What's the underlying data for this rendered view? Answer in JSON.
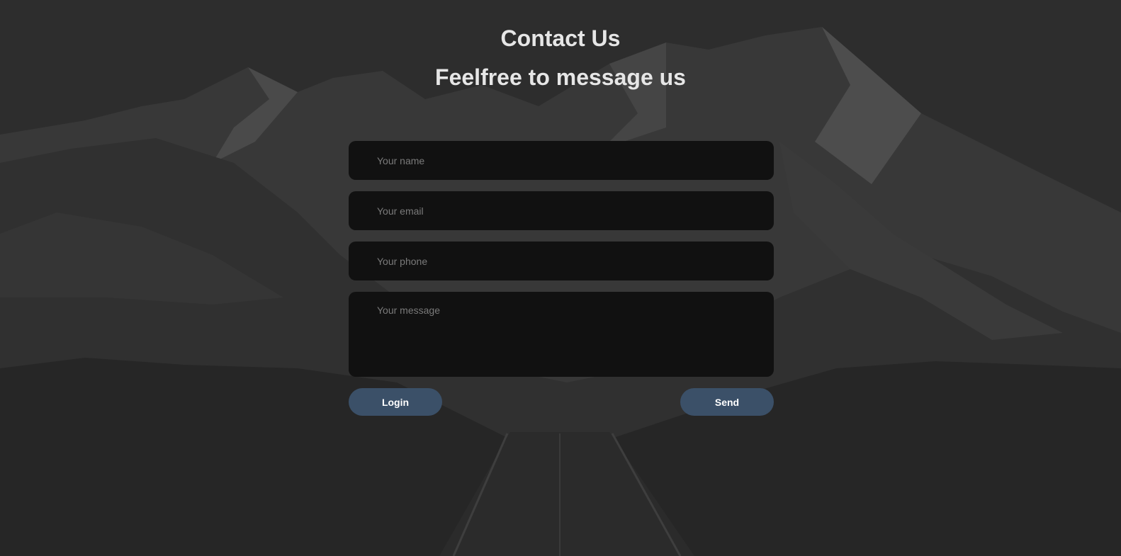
{
  "page": {
    "title": "Contact Us",
    "subtitle": "Feelfree to message us"
  },
  "form": {
    "name_placeholder": "Your name",
    "email_placeholder": "Your email",
    "phone_placeholder": "Your phone",
    "message_placeholder": "Your message",
    "name_value": "",
    "email_value": "",
    "phone_value": "",
    "message_value": ""
  },
  "buttons": {
    "login_label": "Login",
    "send_label": "Send"
  },
  "colors": {
    "overlay": "#2c2c2c",
    "field_bg": "#111111",
    "button_bg": "#3b5068",
    "heading_text": "#e6e6e6"
  },
  "background": {
    "image": "mountain-road-landscape"
  }
}
